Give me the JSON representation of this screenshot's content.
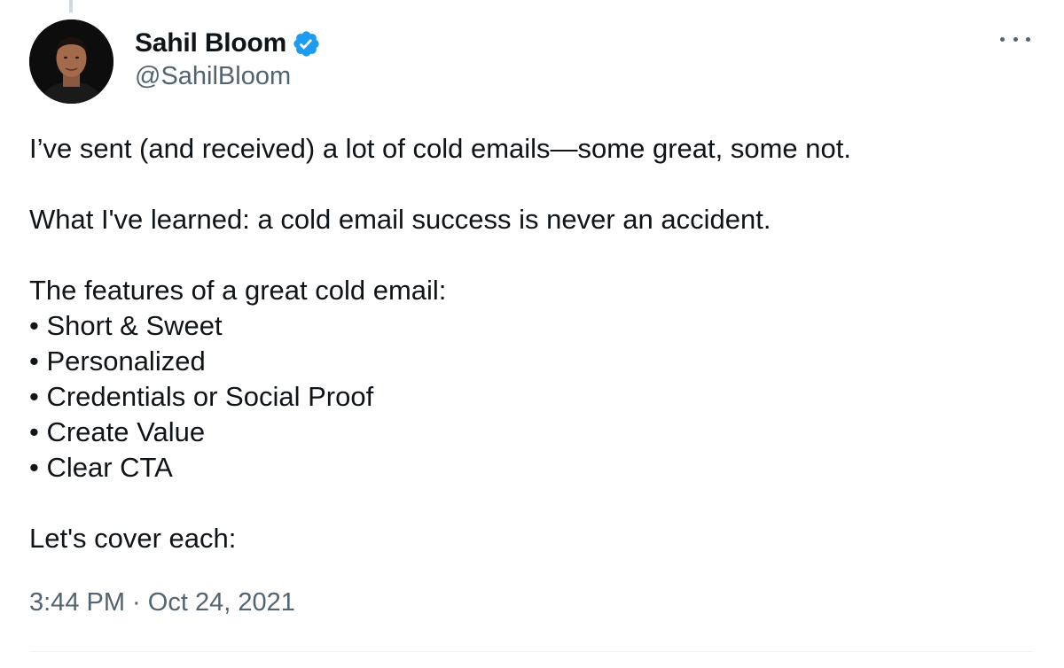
{
  "author": {
    "display_name": "Sahil Bloom",
    "handle": "@SahilBloom",
    "verified_color": "#1d9bf0"
  },
  "tweet": {
    "intro": "I’ve sent (and received) a lot of cold emails—some great, some not.",
    "learned": "What I've learned: a cold email success is never an accident.",
    "features_heading": "The features of a great cold email:",
    "features": [
      "• Short & Sweet",
      "• Personalized",
      "• Credentials or Social Proof",
      "• Create Value",
      "• Clear CTA"
    ],
    "closing": "Let's cover each:"
  },
  "meta": {
    "timestamp": "3:44 PM · Oct 24, 2021"
  },
  "icons": {
    "more": "more-horizontal-icon",
    "verified": "verified-badge-icon"
  }
}
